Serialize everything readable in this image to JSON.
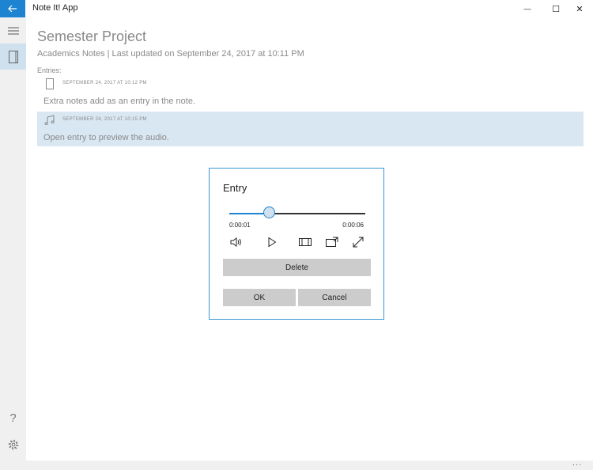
{
  "window": {
    "title": "Note It! App",
    "minimize_glyph": "—",
    "maximize_glyph": "☐",
    "close_glyph": "✕"
  },
  "sidebar": {
    "help_glyph": "?",
    "icons": [
      "hamburger-icon",
      "notebook-icon",
      "help-icon",
      "gear-icon"
    ]
  },
  "note": {
    "title": "Semester Project",
    "subtitle": "Academics Notes | Last updated on September 24, 2017 at 10:11 PM",
    "entries_label": "Entries:"
  },
  "entries": [
    {
      "icon": "document-icon",
      "date": "SEPTEMBER 24, 2017 AT 10:12 PM",
      "text": "Extra notes add as an entry in the note."
    },
    {
      "icon": "music-note-icon",
      "date": "SEPTEMBER 24, 2017 AT 10:15 PM",
      "text": "Open entry to preview the audio."
    }
  ],
  "dialog": {
    "title": "Entry",
    "time_current": "0:00:01",
    "time_total": "0:00:06",
    "progress": 0.29,
    "delete_label": "Delete",
    "ok_label": "OK",
    "cancel_label": "Cancel"
  },
  "status": {
    "more": "..."
  },
  "colors": {
    "accent": "#1e84d2",
    "selection": "#d9e7f2",
    "dialog_border": "#3b97d3",
    "button_gray": "#cccccc"
  }
}
